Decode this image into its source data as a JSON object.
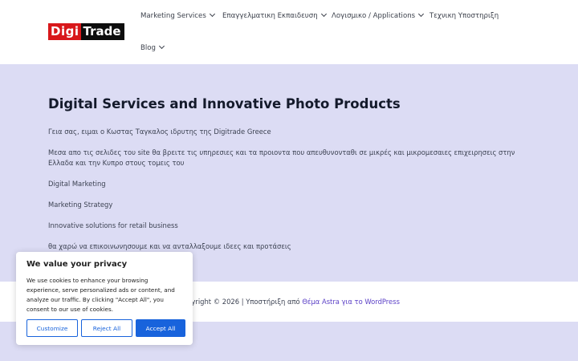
{
  "logo": {
    "part1": "Digi",
    "part2": "Trade"
  },
  "nav": [
    {
      "label": "Marketing Services",
      "has_dropdown": true
    },
    {
      "label": "Επαγγελματικη Εκπαιδευση",
      "has_dropdown": true
    },
    {
      "label": "Λογισμικο / Applications",
      "has_dropdown": true
    },
    {
      "label": "Τεχνικη Υποστηριξη",
      "has_dropdown": false
    },
    {
      "label": "Blog",
      "has_dropdown": true
    }
  ],
  "main": {
    "title": "Digital Services and Innovative Photo Products",
    "paragraphs": [
      "Γεια σας, ειμαι ο Κωστας Ταγκαλος ιδρυτης της Digitrade Greece",
      "Μεσα απο τις σελιδες του site θα βρειτε τις υπηρεσιες και τα προιοντα που απευθυνονταθι σε μικρές και μικρομεσαιες επιχειρησεις στην Ελλαδα και την Κυπρο στους τομεις του",
      "Digital Marketing",
      "Marketing Strategy",
      "Innovative solutions for retail business",
      "θα χαρώ να επικοινωνησουμε και να ανταλλαξουμε ιδεες και προτάσεις"
    ]
  },
  "footer": {
    "copyright": "opyright © 2026 | Υποστήριξη από ",
    "theme_link": "Θέμα Astra για το WordPress"
  },
  "cookie": {
    "title": "We value your privacy",
    "text": "We use cookies to enhance your browsing experience, serve personalized ads or content, and analyze our traffic. By clicking \"Accept All\", you consent to our use of cookies.",
    "customize": "Customize",
    "reject": "Reject All",
    "accept": "Accept All"
  },
  "colors": {
    "brand_red": "#d8181b",
    "page_bg": "#dcdcf4",
    "accent_blue": "#1863dc",
    "link_purple": "#5a3fc6"
  }
}
